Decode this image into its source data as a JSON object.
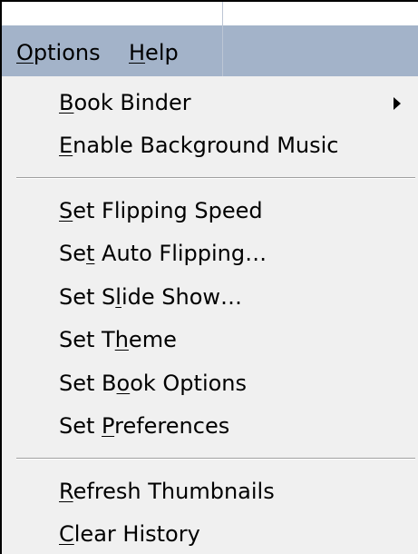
{
  "menubar": {
    "options": {
      "label": "Options",
      "mnemonic": "O",
      "rest": "ptions"
    },
    "help": {
      "label": "Help",
      "mnemonic": "H",
      "rest": "elp"
    }
  },
  "menu": {
    "items": [
      {
        "label": "Book Binder",
        "pre": "",
        "mn": "B",
        "post": "ook Binder",
        "submenu": true
      },
      {
        "label": "Enable Background Music",
        "pre": "",
        "mn": "E",
        "post": "nable Background Music"
      },
      {
        "label": "Set Flipping Speed",
        "pre": "",
        "mn": "S",
        "post": "et Flipping Speed"
      },
      {
        "label": "Set Auto Flipping...",
        "pre": "Se",
        "mn": "t",
        "post": " Auto Flipping…"
      },
      {
        "label": "Set Slide Show...",
        "pre": "Set S",
        "mn": "l",
        "post": "ide Show…"
      },
      {
        "label": "Set Theme",
        "pre": "Set T",
        "mn": "h",
        "post": "eme"
      },
      {
        "label": "Set Book Options",
        "pre": "Set B",
        "mn": "o",
        "post": "ok Options"
      },
      {
        "label": "Set Preferences",
        "pre": "Set ",
        "mn": "P",
        "post": "references"
      },
      {
        "label": "Refresh Thumbnails",
        "pre": "",
        "mn": "R",
        "post": "efresh Thumbnails"
      },
      {
        "label": "Clear History",
        "pre": "",
        "mn": "C",
        "post": "lear History"
      }
    ]
  },
  "icons": {
    "submenu_arrow": "triangle-right-icon"
  }
}
